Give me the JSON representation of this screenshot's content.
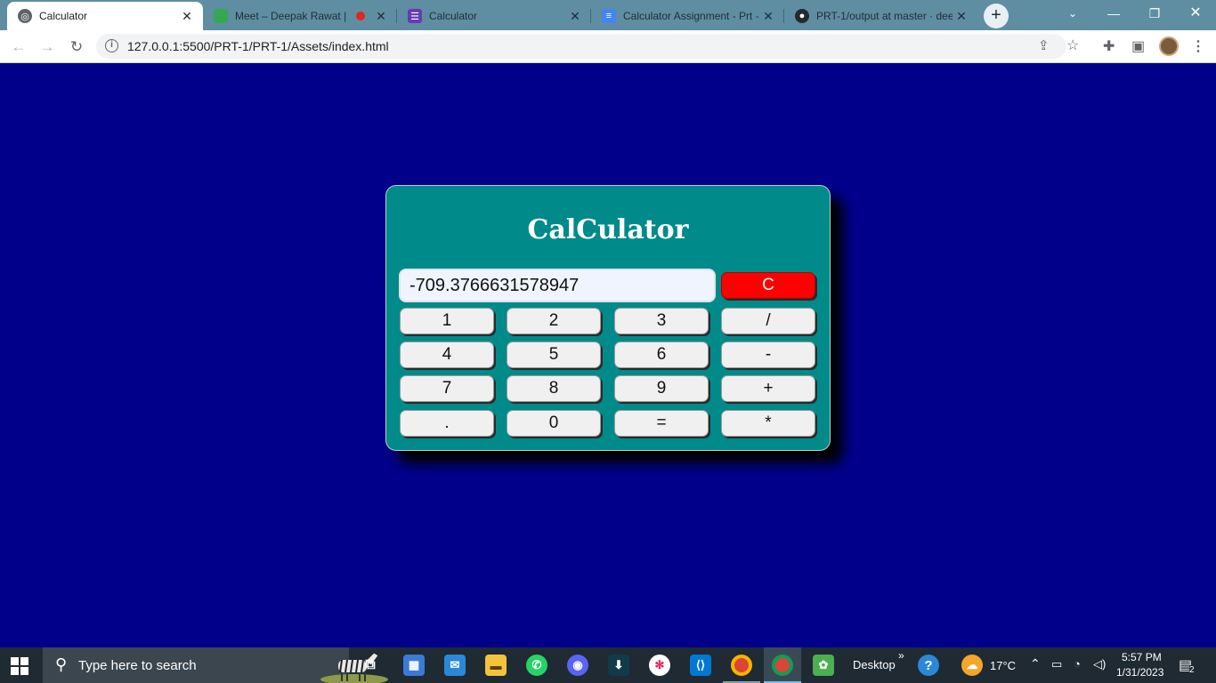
{
  "browser": {
    "tabs": [
      {
        "title": "Calculator",
        "icon": "globe-icon",
        "active": true
      },
      {
        "title": "Meet – Deepak Rawat | C",
        "icon": "google-meet-icon",
        "active": false
      },
      {
        "title": "Calculator",
        "icon": "google-forms-icon",
        "active": false
      },
      {
        "title": "Calculator Assignment - Prt -",
        "icon": "google-docs-icon",
        "active": false
      },
      {
        "title": "PRT-1/output at master · dee",
        "icon": "github-icon",
        "active": false
      }
    ],
    "new_tab_symbol": "+",
    "url": "127.0.0.1:5500/PRT-1/PRT-1/Assets/index.html"
  },
  "calculator": {
    "title": "CalCulator",
    "display_value": "-709.3766631578947",
    "clear_label": "C",
    "keys": [
      [
        "1",
        "2",
        "3",
        "/"
      ],
      [
        "4",
        "5",
        "6",
        "-"
      ],
      [
        "7",
        "8",
        "9",
        "+"
      ],
      [
        ".",
        "0",
        "=",
        "*"
      ]
    ]
  },
  "colors": {
    "page_background": "#00008b",
    "calculator_background": "#008a8a",
    "clear_button": "#ff0000",
    "key_background": "#f0f0f0"
  },
  "taskbar": {
    "search_placeholder": "Type here to search",
    "desktop_label": "Desktop",
    "overflow_label": "»",
    "weather": "17°C",
    "time": "5:57 PM",
    "date": "1/31/2023",
    "notification_count": "2"
  }
}
